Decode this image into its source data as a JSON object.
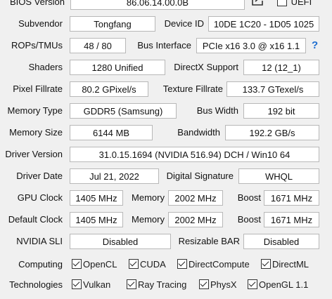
{
  "bios": {
    "label": "BIOS Version",
    "value": "86.06.14.00.0B",
    "uefi_label": "UEFI",
    "uefi_checked": false
  },
  "subvendor": {
    "label": "Subvendor",
    "value": "Tongfang"
  },
  "device_id": {
    "label": "Device ID",
    "value": "10DE 1C20 - 1D05 1025"
  },
  "rops_tmus": {
    "label": "ROPs/TMUs",
    "value": "48 / 80"
  },
  "bus_interface": {
    "label": "Bus Interface",
    "value": "PCIe x16 3.0 @ x16 1.1"
  },
  "help": {
    "label": "?"
  },
  "shaders": {
    "label": "Shaders",
    "value": "1280 Unified"
  },
  "directx": {
    "label": "DirectX Support",
    "value": "12 (12_1)"
  },
  "pixel_fillrate": {
    "label": "Pixel Fillrate",
    "value": "80.2 GPixel/s"
  },
  "texture_fillrate": {
    "label": "Texture Fillrate",
    "value": "133.7 GTexel/s"
  },
  "memory_type": {
    "label": "Memory Type",
    "value": "GDDR5 (Samsung)"
  },
  "bus_width": {
    "label": "Bus Width",
    "value": "192 bit"
  },
  "memory_size": {
    "label": "Memory Size",
    "value": "6144 MB"
  },
  "bandwidth": {
    "label": "Bandwidth",
    "value": "192.2 GB/s"
  },
  "driver_version": {
    "label": "Driver Version",
    "value": "31.0.15.1694 (NVIDIA 516.94) DCH / Win10 64"
  },
  "driver_date": {
    "label": "Driver Date",
    "value": "Jul 21, 2022"
  },
  "digital_signature": {
    "label": "Digital Signature",
    "value": "WHQL"
  },
  "gpu_clock": {
    "label": "GPU Clock",
    "value": "1405 MHz",
    "memory_label": "Memory",
    "memory_value": "2002 MHz",
    "boost_label": "Boost",
    "boost_value": "1671 MHz"
  },
  "default_clock": {
    "label": "Default Clock",
    "value": "1405 MHz",
    "memory_label": "Memory",
    "memory_value": "2002 MHz",
    "boost_label": "Boost",
    "boost_value": "1671 MHz"
  },
  "nvidia_sli": {
    "label": "NVIDIA SLI",
    "value": "Disabled"
  },
  "resizable_bar": {
    "label": "Resizable BAR",
    "value": "Disabled"
  },
  "computing": {
    "label": "Computing",
    "items": [
      {
        "label": "OpenCL",
        "checked": true
      },
      {
        "label": "CUDA",
        "checked": true
      },
      {
        "label": "DirectCompute",
        "checked": true
      },
      {
        "label": "DirectML",
        "checked": true
      }
    ]
  },
  "technologies": {
    "label": "Technologies",
    "items": [
      {
        "label": "Vulkan",
        "checked": true
      },
      {
        "label": "Ray Tracing",
        "checked": true
      },
      {
        "label": "PhysX",
        "checked": true
      },
      {
        "label": "OpenGL 1.1",
        "checked": true
      }
    ]
  }
}
